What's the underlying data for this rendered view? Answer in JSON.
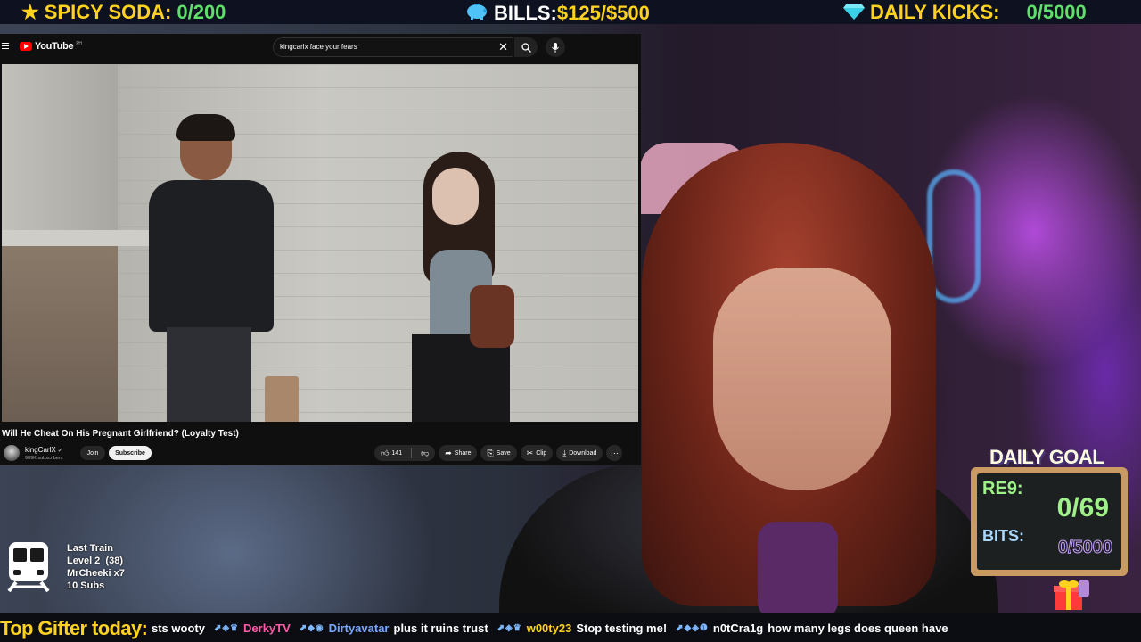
{
  "goals": {
    "soda": {
      "label": "SPICY SODA:",
      "value": "0/200",
      "icon": "star-icon"
    },
    "bills": {
      "label": "BILLS:",
      "value": "$125/$500",
      "icon": "piggy-bank-icon"
    },
    "kicks": {
      "label": "DAILY KICKS:",
      "value": "0/5000",
      "icon": "diamond-icon"
    }
  },
  "youtube": {
    "logo_text": "YouTube",
    "logo_region": "PH",
    "search_value": "kingcarlx face your fears",
    "video_title": "Will He Cheat On His Pregnant Girlfriend? (Loyalty Test)",
    "channel": {
      "name": "kingCarlX",
      "subscribers": "909K subscribers"
    },
    "join_label": "Join",
    "subscribe_label": "Subscribe",
    "like_count": "141",
    "share_label": "Share",
    "save_label": "Save",
    "clip_label": "Clip",
    "download_label": "Download"
  },
  "train": {
    "title": "Last Train",
    "level": "Level 2  (38)",
    "user": "MrCheeki x7",
    "subs": "10 Subs"
  },
  "daily_goal": {
    "title": "DAILY GOAL",
    "subs_label": "RE9:",
    "subs_value": "0/69",
    "bits_label": "BITS:",
    "bits_value": "0/5000"
  },
  "ticker": {
    "top_gifter_label": "Top Gifter today:",
    "messages": [
      {
        "user": "",
        "color": "#ffffff",
        "badges": "",
        "text": "sts wooty"
      },
      {
        "user": "DerkyTV",
        "color": "#ff5aa8",
        "badges": "⬈◈♛",
        "text": ""
      },
      {
        "user": "Dirtyavatar",
        "color": "#7aa8ff",
        "badges": "⬈◆◉",
        "text": "plus it ruins trust"
      },
      {
        "user": "w00ty23",
        "color": "#ffd21f",
        "badges": "⬈◈♛",
        "text": "Stop testing me!"
      },
      {
        "user": "n0tCra1g",
        "color": "#ffffff",
        "badges": "⬈◆◈❶",
        "text": "how many legs does queen have"
      }
    ]
  },
  "colors": {
    "goal_label": "#ffd21f",
    "goal_value": "#5fe06a",
    "yt_red": "#ff0000",
    "chalk_green": "#9ff28a"
  }
}
